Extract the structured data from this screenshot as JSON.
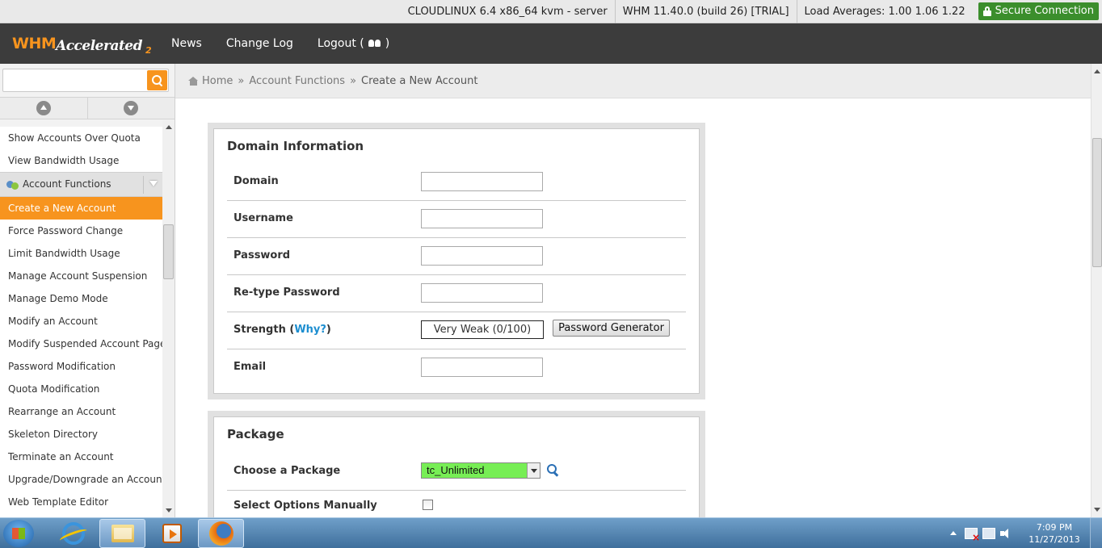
{
  "topbar": {
    "os": "CLOUDLINUX 6.4 x86_64 kvm - server",
    "version": "WHM 11.40.0 (build 26) [TRIAL]",
    "load": "Load Averages: 1.00 1.06 1.22",
    "secure": "Secure Connection"
  },
  "header": {
    "logo_whm": "WHM",
    "logo_accel": "Accelerated",
    "logo_two": "2",
    "nav": {
      "news": "News",
      "changelog": "Change Log",
      "logout": "Logout (",
      "logout_close": ")"
    }
  },
  "sidebar": {
    "search_placeholder": "",
    "items_top": [
      "Show Accounts Over Quota",
      "View Bandwidth Usage"
    ],
    "group": "Account Functions",
    "active": "Create a New Account",
    "items": [
      "Force Password Change",
      "Limit Bandwidth Usage",
      "Manage Account Suspension",
      "Manage Demo Mode",
      "Modify an Account",
      "Modify Suspended Account Page",
      "Password Modification",
      "Quota Modification",
      "Rearrange an Account",
      "Skeleton Directory",
      "Terminate an Account",
      "Upgrade/Downgrade an Account",
      "Web Template Editor"
    ]
  },
  "breadcrumb": {
    "home": "Home",
    "sep": "»",
    "section": "Account Functions",
    "current": "Create a New Account"
  },
  "domain_info": {
    "title": "Domain Information",
    "domain_label": "Domain",
    "domain_value": "",
    "username_label": "Username",
    "username_value": "",
    "password_label": "Password",
    "password_value": "",
    "retype_label": "Re-type Password",
    "retype_value": "",
    "strength_label": "Strength (",
    "strength_why": "Why?",
    "strength_close": ")",
    "strength_value": "Very Weak (0/100)",
    "pwgen_label": "Password Generator",
    "email_label": "Email",
    "email_value": ""
  },
  "package": {
    "title": "Package",
    "choose_label": "Choose a Package",
    "choose_value": "tc_Unlimited",
    "manual_label": "Select Options Manually",
    "manual_checked": false
  },
  "taskbar": {
    "time": "7:09 PM",
    "date": "11/27/2013"
  },
  "colors": {
    "accent": "#f7941e",
    "header_bg": "#3c3c3c",
    "secure_bg": "#3b8e2c",
    "package_select_bg": "#77ee55",
    "link": "#1d8ed0"
  }
}
